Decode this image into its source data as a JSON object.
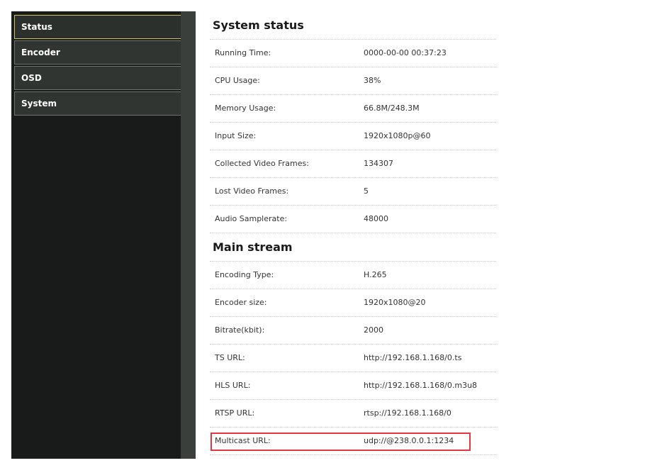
{
  "sidebar": {
    "items": [
      {
        "label": "Status",
        "active": true
      },
      {
        "label": "Encoder",
        "active": false
      },
      {
        "label": "OSD",
        "active": false
      },
      {
        "label": "System",
        "active": false
      }
    ]
  },
  "system_status": {
    "title": "System status",
    "rows": [
      {
        "label": "Running Time:",
        "value": "0000-00-00 00:37:23"
      },
      {
        "label": "CPU Usage:",
        "value": "38%"
      },
      {
        "label": "Memory Usage:",
        "value": "66.8M/248.3M"
      },
      {
        "label": "Input Size:",
        "value": "1920x1080p@60"
      },
      {
        "label": "Collected Video Frames:",
        "value": "134307"
      },
      {
        "label": "Lost Video Frames:",
        "value": "5"
      },
      {
        "label": "Audio Samplerate:",
        "value": "48000"
      }
    ]
  },
  "main_stream": {
    "title": "Main stream",
    "rows": [
      {
        "label": "Encoding Type:",
        "value": "H.265"
      },
      {
        "label": "Encoder size:",
        "value": "1920x1080@20"
      },
      {
        "label": "Bitrate(kbit):",
        "value": "2000"
      },
      {
        "label": "TS URL:",
        "value": "http://192.168.1.168/0.ts"
      },
      {
        "label": "HLS URL:",
        "value": "http://192.168.1.168/0.m3u8"
      },
      {
        "label": "RTSP URL:",
        "value": "rtsp://192.168.1.168/0"
      },
      {
        "label": "Multicast URL:",
        "value": "udp://@238.0.0.1:1234"
      }
    ]
  },
  "colors": {
    "sidebar_bg": "#191b1a",
    "nav_active_border": "#d4c25a",
    "highlight": "#e0383e"
  }
}
